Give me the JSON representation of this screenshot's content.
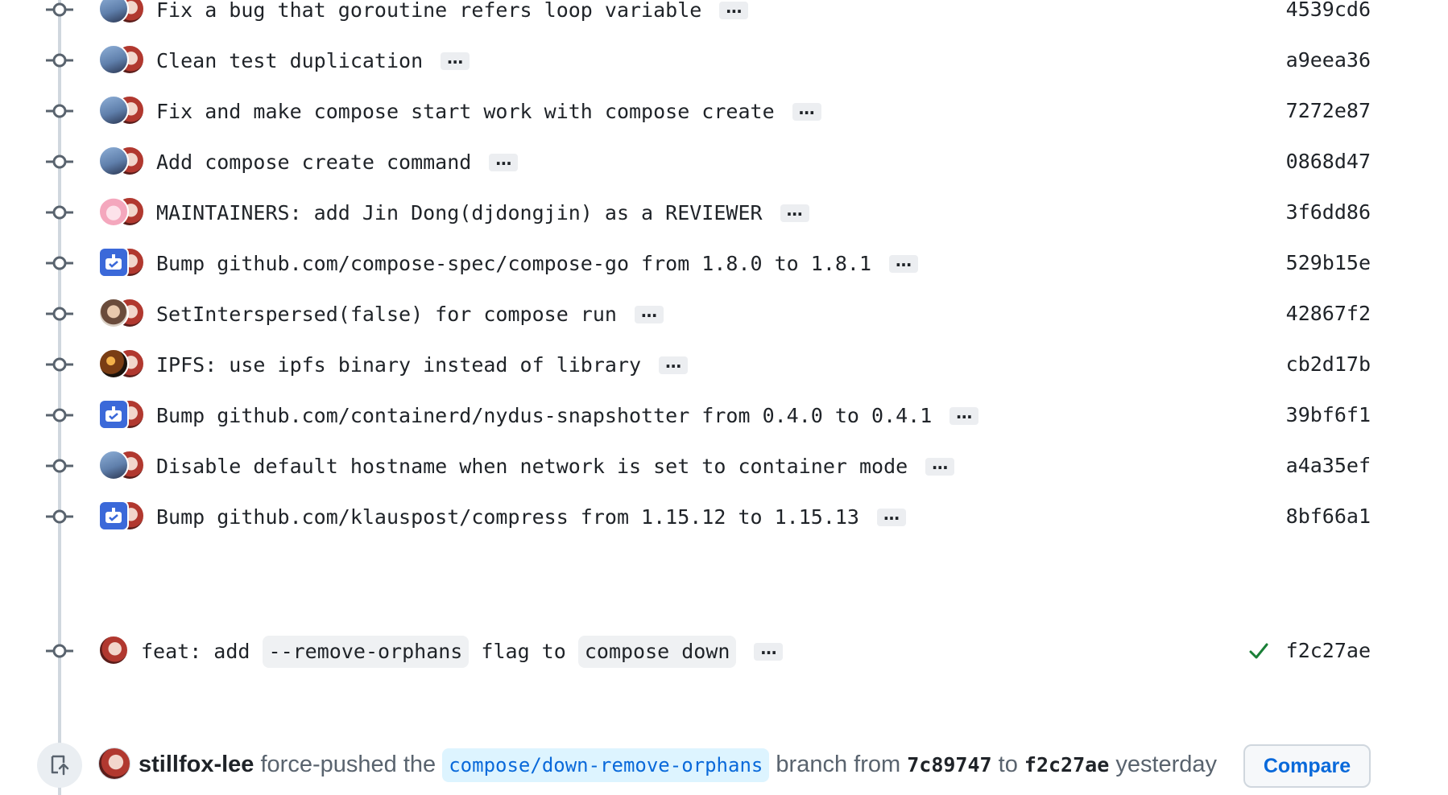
{
  "commits": [
    {
      "message": "Fix a bug that goroutine refers loop variable",
      "sha": "4539cd6",
      "author_avatar": "person-blue"
    },
    {
      "message": "Clean test duplication",
      "sha": "a9eea36",
      "author_avatar": "person-blue"
    },
    {
      "message": "Fix and make compose start work with compose create",
      "sha": "7272e87",
      "author_avatar": "person-blue"
    },
    {
      "message": "Add compose create command",
      "sha": "0868d47",
      "author_avatar": "person-blue"
    },
    {
      "message": "MAINTAINERS: add Jin Dong(djdongjin) as a REVIEWER",
      "sha": "3f6dd86",
      "author_avatar": "pink-avatar"
    },
    {
      "message": "Bump github.com/compose-spec/compose-go from 1.8.0 to 1.8.1",
      "sha": "529b15e",
      "author_avatar": "bot"
    },
    {
      "message": "SetInterspersed(false) for compose run",
      "sha": "42867f2",
      "author_avatar": "person-face"
    },
    {
      "message": "IPFS: use ipfs binary instead of library",
      "sha": "cb2d17b",
      "author_avatar": "dark-avatar"
    },
    {
      "message": "Bump github.com/containerd/nydus-snapshotter from 0.4.0 to 0.4.1",
      "sha": "39bf6f1",
      "author_avatar": "bot"
    },
    {
      "message": "Disable default hostname when network is set to container mode",
      "sha": "a4a35ef",
      "author_avatar": "person-blue"
    },
    {
      "message": "Bump github.com/klauspost/compress from 1.15.12 to 1.15.13",
      "sha": "8bf66a1",
      "author_avatar": "bot"
    }
  ],
  "last_commit": {
    "parts": [
      "feat: add",
      "--remove-orphans",
      "flag to",
      "compose down"
    ],
    "sha": "f2c27ae",
    "status": "success"
  },
  "ellipsis_label": "…",
  "force_push": {
    "user": "stillfox-lee",
    "action_before": "force-pushed the",
    "branch": "compose/down-remove-orphans",
    "from_label": "branch from",
    "from_sha": "7c89747",
    "to_label": "to",
    "to_sha": "f2c27ae",
    "time": "yesterday",
    "compare_label": "Compare"
  },
  "colors": {
    "accent": "#0969da",
    "success": "#1a7f37",
    "timeline": "#d0d7de"
  }
}
